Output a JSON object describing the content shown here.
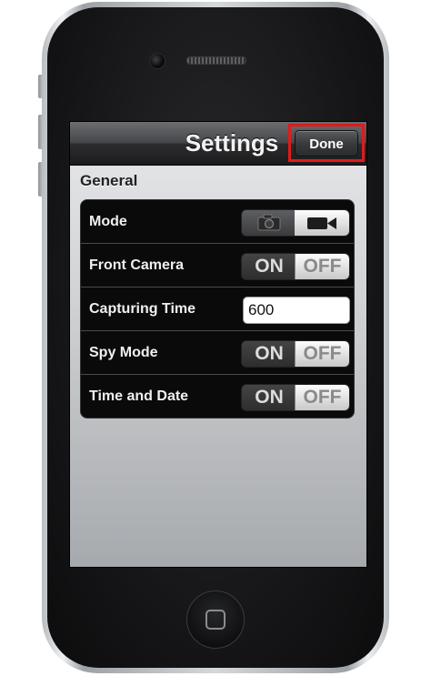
{
  "navbar": {
    "title": "Settings",
    "done_label": "Done"
  },
  "section": {
    "title": "General"
  },
  "rows": [
    {
      "label": "Mode",
      "control": "mode-toggle"
    },
    {
      "label": "Front Camera",
      "control": "toggle",
      "on_label": "ON",
      "off_label": "OFF"
    },
    {
      "label": "Capturing Time",
      "control": "text-field",
      "value": "600"
    },
    {
      "label": "Spy Mode",
      "control": "toggle",
      "on_label": "ON",
      "off_label": "OFF"
    },
    {
      "label": "Time and Date",
      "control": "toggle",
      "on_label": "ON",
      "off_label": "OFF"
    }
  ],
  "icons": {
    "mode_photo": "camera-icon",
    "mode_video": "video-camera-icon"
  },
  "colors": {
    "highlight": "#e01b1b",
    "navbar": "#2b2c2e",
    "group_background": "#0a0a0a"
  }
}
